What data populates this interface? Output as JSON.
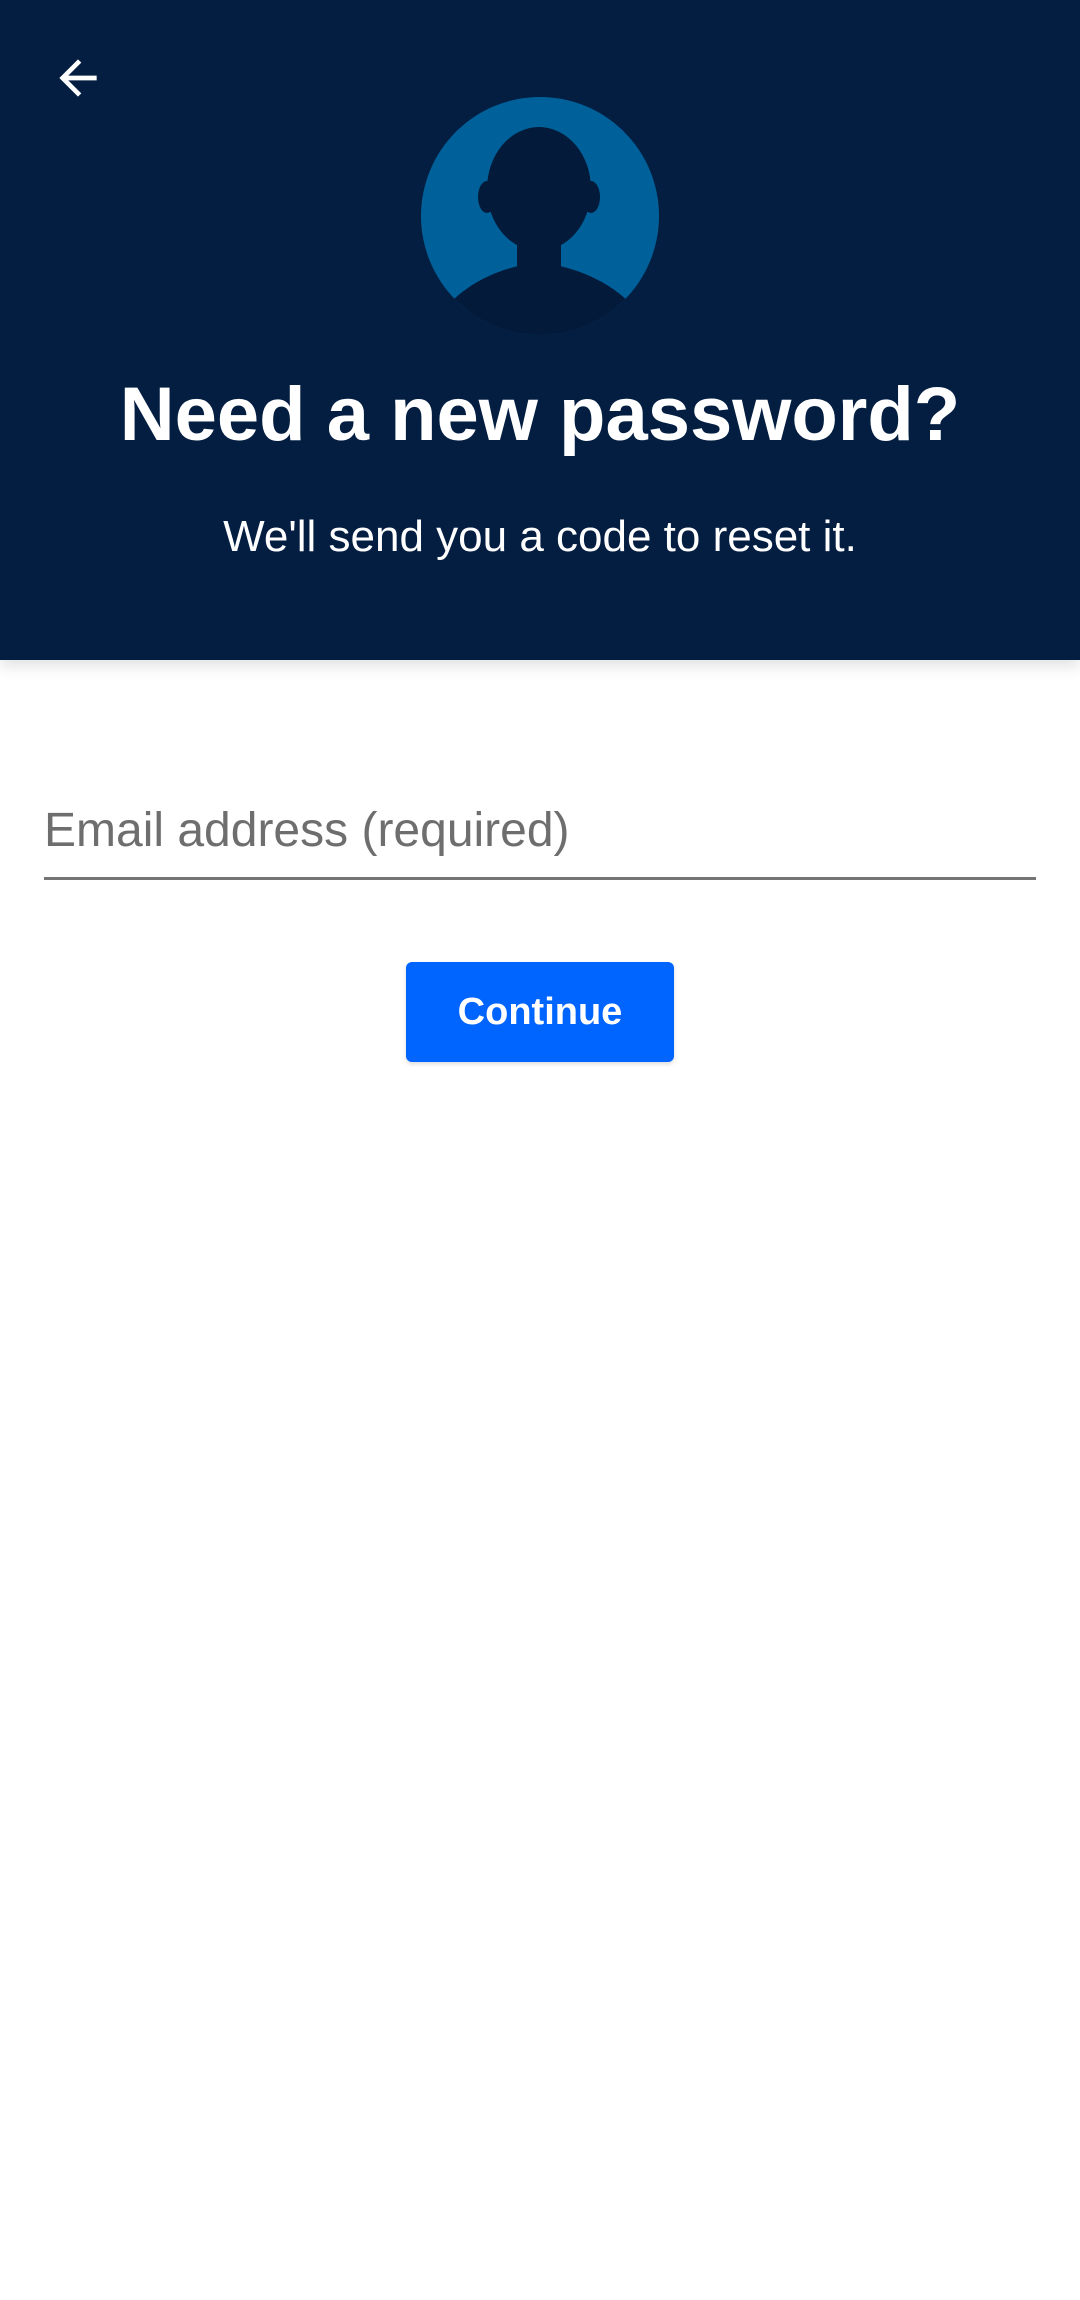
{
  "header": {
    "back_icon": "arrow-left-icon",
    "avatar_icon": "person-silhouette-icon",
    "title": "Need a new password?",
    "subtitle": "We'll send you a code to reset it.",
    "background_color": "#041e42",
    "avatar_color": "#006099"
  },
  "form": {
    "email_placeholder": "Email address (required)",
    "email_value": "",
    "continue_label": "Continue",
    "button_color": "#0064ff"
  }
}
